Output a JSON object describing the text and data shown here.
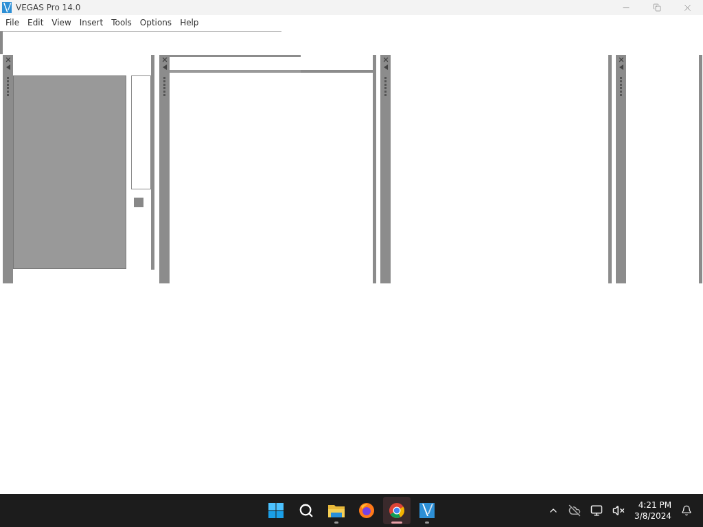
{
  "window": {
    "title": "VEGAS Pro 14.0"
  },
  "menu": [
    {
      "label": "File"
    },
    {
      "label": "Edit"
    },
    {
      "label": "View"
    },
    {
      "label": "Insert"
    },
    {
      "label": "Tools"
    },
    {
      "label": "Options"
    },
    {
      "label": "Help"
    }
  ],
  "docked_panels": [
    {
      "kind": "preview"
    },
    {
      "kind": "list"
    },
    {
      "kind": "empty"
    },
    {
      "kind": "narrow"
    }
  ],
  "taskbar": {
    "apps": [
      {
        "kind": "start",
        "running": false,
        "active": false
      },
      {
        "kind": "search",
        "running": false,
        "active": false
      },
      {
        "kind": "folder",
        "running": true,
        "active": false
      },
      {
        "kind": "firefox",
        "running": false,
        "active": false
      },
      {
        "kind": "chrome",
        "running": true,
        "active": true
      },
      {
        "kind": "vegas",
        "running": true,
        "active": false
      }
    ],
    "time": "4:21 PM",
    "date": "3/8/2024"
  }
}
